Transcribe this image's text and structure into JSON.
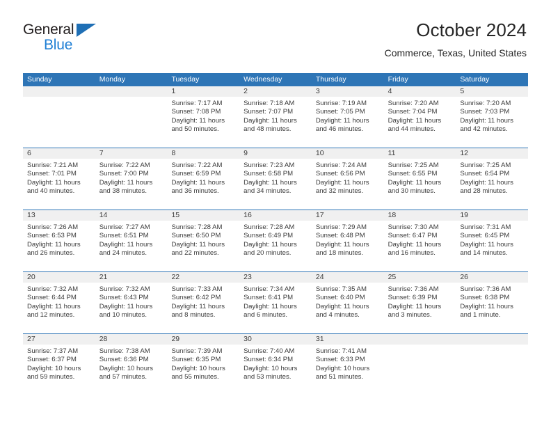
{
  "logo": {
    "word1": "General",
    "word2": "Blue",
    "triangle_color": "#1f6fb5",
    "blue_text_color": "#1f7fd4"
  },
  "header": {
    "title": "October 2024",
    "location": "Commerce, Texas, United States",
    "accent_color": "#2e75b6"
  },
  "weekdays": [
    "Sunday",
    "Monday",
    "Tuesday",
    "Wednesday",
    "Thursday",
    "Friday",
    "Saturday"
  ],
  "weeks": [
    [
      {
        "day": "",
        "empty": true
      },
      {
        "day": "",
        "empty": true
      },
      {
        "day": "1",
        "sunrise": "Sunrise: 7:17 AM",
        "sunset": "Sunset: 7:08 PM",
        "daylight1": "Daylight: 11 hours",
        "daylight2": "and 50 minutes."
      },
      {
        "day": "2",
        "sunrise": "Sunrise: 7:18 AM",
        "sunset": "Sunset: 7:07 PM",
        "daylight1": "Daylight: 11 hours",
        "daylight2": "and 48 minutes."
      },
      {
        "day": "3",
        "sunrise": "Sunrise: 7:19 AM",
        "sunset": "Sunset: 7:05 PM",
        "daylight1": "Daylight: 11 hours",
        "daylight2": "and 46 minutes."
      },
      {
        "day": "4",
        "sunrise": "Sunrise: 7:20 AM",
        "sunset": "Sunset: 7:04 PM",
        "daylight1": "Daylight: 11 hours",
        "daylight2": "and 44 minutes."
      },
      {
        "day": "5",
        "sunrise": "Sunrise: 7:20 AM",
        "sunset": "Sunset: 7:03 PM",
        "daylight1": "Daylight: 11 hours",
        "daylight2": "and 42 minutes."
      }
    ],
    [
      {
        "day": "6",
        "sunrise": "Sunrise: 7:21 AM",
        "sunset": "Sunset: 7:01 PM",
        "daylight1": "Daylight: 11 hours",
        "daylight2": "and 40 minutes."
      },
      {
        "day": "7",
        "sunrise": "Sunrise: 7:22 AM",
        "sunset": "Sunset: 7:00 PM",
        "daylight1": "Daylight: 11 hours",
        "daylight2": "and 38 minutes."
      },
      {
        "day": "8",
        "sunrise": "Sunrise: 7:22 AM",
        "sunset": "Sunset: 6:59 PM",
        "daylight1": "Daylight: 11 hours",
        "daylight2": "and 36 minutes."
      },
      {
        "day": "9",
        "sunrise": "Sunrise: 7:23 AM",
        "sunset": "Sunset: 6:58 PM",
        "daylight1": "Daylight: 11 hours",
        "daylight2": "and 34 minutes."
      },
      {
        "day": "10",
        "sunrise": "Sunrise: 7:24 AM",
        "sunset": "Sunset: 6:56 PM",
        "daylight1": "Daylight: 11 hours",
        "daylight2": "and 32 minutes."
      },
      {
        "day": "11",
        "sunrise": "Sunrise: 7:25 AM",
        "sunset": "Sunset: 6:55 PM",
        "daylight1": "Daylight: 11 hours",
        "daylight2": "and 30 minutes."
      },
      {
        "day": "12",
        "sunrise": "Sunrise: 7:25 AM",
        "sunset": "Sunset: 6:54 PM",
        "daylight1": "Daylight: 11 hours",
        "daylight2": "and 28 minutes."
      }
    ],
    [
      {
        "day": "13",
        "sunrise": "Sunrise: 7:26 AM",
        "sunset": "Sunset: 6:53 PM",
        "daylight1": "Daylight: 11 hours",
        "daylight2": "and 26 minutes."
      },
      {
        "day": "14",
        "sunrise": "Sunrise: 7:27 AM",
        "sunset": "Sunset: 6:51 PM",
        "daylight1": "Daylight: 11 hours",
        "daylight2": "and 24 minutes."
      },
      {
        "day": "15",
        "sunrise": "Sunrise: 7:28 AM",
        "sunset": "Sunset: 6:50 PM",
        "daylight1": "Daylight: 11 hours",
        "daylight2": "and 22 minutes."
      },
      {
        "day": "16",
        "sunrise": "Sunrise: 7:28 AM",
        "sunset": "Sunset: 6:49 PM",
        "daylight1": "Daylight: 11 hours",
        "daylight2": "and 20 minutes."
      },
      {
        "day": "17",
        "sunrise": "Sunrise: 7:29 AM",
        "sunset": "Sunset: 6:48 PM",
        "daylight1": "Daylight: 11 hours",
        "daylight2": "and 18 minutes."
      },
      {
        "day": "18",
        "sunrise": "Sunrise: 7:30 AM",
        "sunset": "Sunset: 6:47 PM",
        "daylight1": "Daylight: 11 hours",
        "daylight2": "and 16 minutes."
      },
      {
        "day": "19",
        "sunrise": "Sunrise: 7:31 AM",
        "sunset": "Sunset: 6:45 PM",
        "daylight1": "Daylight: 11 hours",
        "daylight2": "and 14 minutes."
      }
    ],
    [
      {
        "day": "20",
        "sunrise": "Sunrise: 7:32 AM",
        "sunset": "Sunset: 6:44 PM",
        "daylight1": "Daylight: 11 hours",
        "daylight2": "and 12 minutes."
      },
      {
        "day": "21",
        "sunrise": "Sunrise: 7:32 AM",
        "sunset": "Sunset: 6:43 PM",
        "daylight1": "Daylight: 11 hours",
        "daylight2": "and 10 minutes."
      },
      {
        "day": "22",
        "sunrise": "Sunrise: 7:33 AM",
        "sunset": "Sunset: 6:42 PM",
        "daylight1": "Daylight: 11 hours",
        "daylight2": "and 8 minutes."
      },
      {
        "day": "23",
        "sunrise": "Sunrise: 7:34 AM",
        "sunset": "Sunset: 6:41 PM",
        "daylight1": "Daylight: 11 hours",
        "daylight2": "and 6 minutes."
      },
      {
        "day": "24",
        "sunrise": "Sunrise: 7:35 AM",
        "sunset": "Sunset: 6:40 PM",
        "daylight1": "Daylight: 11 hours",
        "daylight2": "and 4 minutes."
      },
      {
        "day": "25",
        "sunrise": "Sunrise: 7:36 AM",
        "sunset": "Sunset: 6:39 PM",
        "daylight1": "Daylight: 11 hours",
        "daylight2": "and 3 minutes."
      },
      {
        "day": "26",
        "sunrise": "Sunrise: 7:36 AM",
        "sunset": "Sunset: 6:38 PM",
        "daylight1": "Daylight: 11 hours",
        "daylight2": "and 1 minute."
      }
    ],
    [
      {
        "day": "27",
        "sunrise": "Sunrise: 7:37 AM",
        "sunset": "Sunset: 6:37 PM",
        "daylight1": "Daylight: 10 hours",
        "daylight2": "and 59 minutes."
      },
      {
        "day": "28",
        "sunrise": "Sunrise: 7:38 AM",
        "sunset": "Sunset: 6:36 PM",
        "daylight1": "Daylight: 10 hours",
        "daylight2": "and 57 minutes."
      },
      {
        "day": "29",
        "sunrise": "Sunrise: 7:39 AM",
        "sunset": "Sunset: 6:35 PM",
        "daylight1": "Daylight: 10 hours",
        "daylight2": "and 55 minutes."
      },
      {
        "day": "30",
        "sunrise": "Sunrise: 7:40 AM",
        "sunset": "Sunset: 6:34 PM",
        "daylight1": "Daylight: 10 hours",
        "daylight2": "and 53 minutes."
      },
      {
        "day": "31",
        "sunrise": "Sunrise: 7:41 AM",
        "sunset": "Sunset: 6:33 PM",
        "daylight1": "Daylight: 10 hours",
        "daylight2": "and 51 minutes."
      },
      {
        "day": "",
        "empty": true
      },
      {
        "day": "",
        "empty": true
      }
    ]
  ]
}
